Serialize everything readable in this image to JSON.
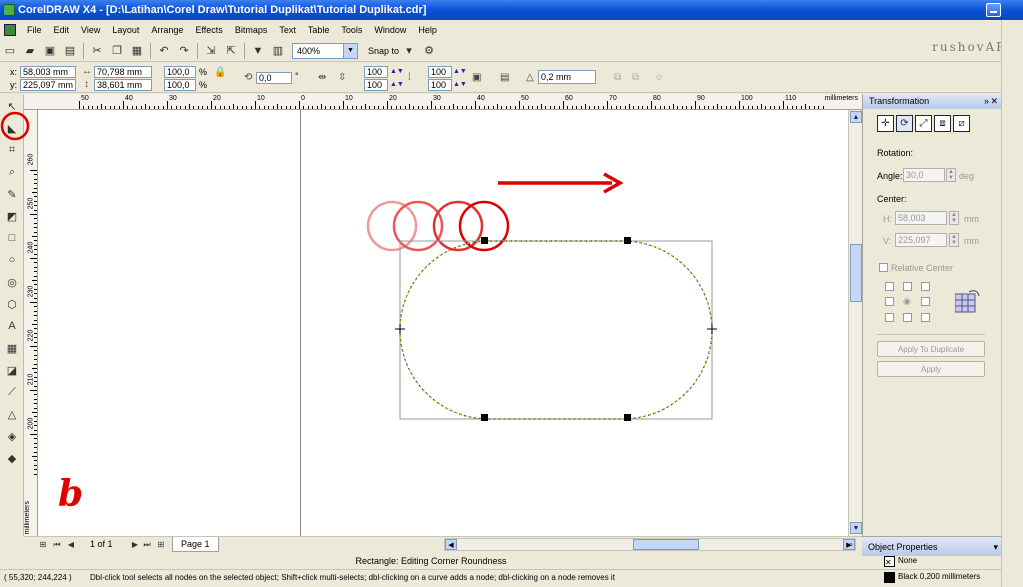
{
  "window": {
    "title": "CorelDRAW X4 - [D:\\Latihan\\Corel Draw\\Tutorial Duplikat\\Tutorial Duplikat.cdr]"
  },
  "menu": [
    "File",
    "Edit",
    "View",
    "Layout",
    "Arrange",
    "Effects",
    "Bitmaps",
    "Text",
    "Table",
    "Tools",
    "Window",
    "Help"
  ],
  "toolbar": {
    "zoom": "400%",
    "snap_to": "Snap to",
    "brand": "rushovART"
  },
  "propbar": {
    "x": "58,003 mm",
    "y": "225,097 mm",
    "width": "70,798 mm",
    "height": "38,601 mm",
    "scale_x": "100,0",
    "scale_y": "100,0",
    "pct": "%",
    "rotation": "0,0",
    "deg": "°",
    "corner_tl": "100",
    "corner_bl": "100",
    "corner_tr": "100",
    "corner_br": "100",
    "outline": "0,2 mm"
  },
  "ruler": {
    "h_labels": [
      "50",
      "40",
      "30",
      "20",
      "10",
      "0",
      "10",
      "20",
      "30",
      "40",
      "50",
      "60",
      "70",
      "80",
      "90",
      "100",
      "110"
    ],
    "h_units": "millimeters",
    "v_labels": [
      "260",
      "250",
      "240",
      "230",
      "220",
      "210",
      "200"
    ],
    "v_units": "millimeters"
  },
  "docker": {
    "title": "Transformation",
    "rotation_label": "Rotation:",
    "angle_label": "Angle:",
    "angle_value": "30,0",
    "angle_unit": "deg",
    "center_label": "Center:",
    "h_label": "H:",
    "h_value": "58,003",
    "h_unit": "mm",
    "v_label": "V:",
    "v_value": "225,097",
    "v_unit": "mm",
    "relative_center": "Relative Center",
    "apply_dup": "Apply To Duplicate",
    "apply": "Apply"
  },
  "pagenav": {
    "counter": "1 of 1",
    "page_tab": "Page 1"
  },
  "objprops": {
    "title": "Object Properties",
    "fill": "None",
    "outline": "Black  0,200 millimeters"
  },
  "status": {
    "object": "Rectangle: Editing Corner Roundness",
    "coords": "( 55,320; 244,224 )",
    "hint": "Dbl-click tool selects all nodes on the selected object; Shift+click multi-selects; dbl-clicking on a curve adds a node; dbl-clicking on a node removes it"
  },
  "annotation": {
    "letter": "b",
    "accent": "#e02020"
  }
}
